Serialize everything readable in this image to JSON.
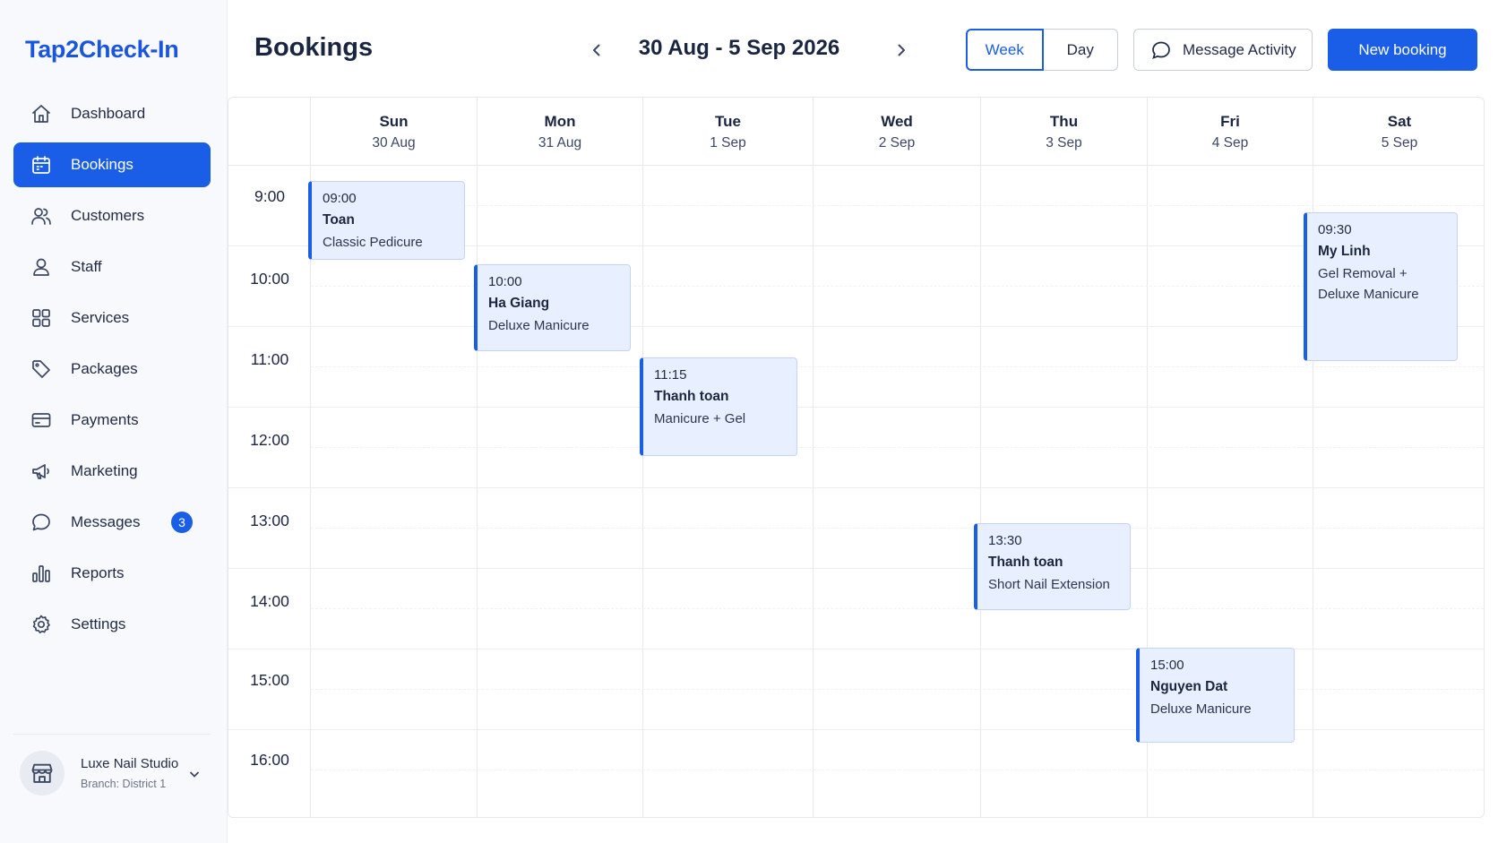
{
  "app": {
    "brand": "Tap2Check-In"
  },
  "sidebar": {
    "items": [
      {
        "label": "Dashboard",
        "icon": "home-icon"
      },
      {
        "label": "Bookings",
        "icon": "calendar-icon",
        "active": true
      },
      {
        "label": "Customers",
        "icon": "users-icon"
      },
      {
        "label": "Staff",
        "icon": "user-icon"
      },
      {
        "label": "Services",
        "icon": "grid-icon"
      },
      {
        "label": "Packages",
        "icon": "tag-icon"
      },
      {
        "label": "Payments",
        "icon": "card-icon"
      },
      {
        "label": "Marketing",
        "icon": "megaphone-icon"
      },
      {
        "label": "Messages",
        "icon": "chat-icon",
        "badge": "3"
      },
      {
        "label": "Reports",
        "icon": "bar-chart-icon"
      },
      {
        "label": "Settings",
        "icon": "gear-icon"
      }
    ],
    "studio": {
      "name": "Luxe Nail Studio",
      "branch": "Branch: District 1"
    }
  },
  "header": {
    "title": "Bookings",
    "date_range": "30 Aug - 5 Sep 2026",
    "view_week": "Week",
    "view_day": "Day",
    "active_view": "Week",
    "message_activity": "Message Activity",
    "new_booking": "New booking"
  },
  "calendar": {
    "days": [
      {
        "name": "Sun",
        "date": "30 Aug"
      },
      {
        "name": "Mon",
        "date": "31 Aug"
      },
      {
        "name": "Tue",
        "date": "1 Sep"
      },
      {
        "name": "Wed",
        "date": "2 Sep"
      },
      {
        "name": "Thu",
        "date": "3 Sep"
      },
      {
        "name": "Fri",
        "date": "4 Sep"
      },
      {
        "name": "Sat",
        "date": "5 Sep"
      }
    ],
    "hours": [
      "9:00",
      "10:00",
      "11:00",
      "12:00",
      "13:00",
      "14:00",
      "15:00",
      "16:00"
    ],
    "bookings": [
      {
        "time": "09:00",
        "name": "Toan",
        "service": "Classic Pedicure",
        "day": "Sun"
      },
      {
        "time": "10:00",
        "name": "Ha Giang",
        "service": "Deluxe Manicure",
        "day": "Mon"
      },
      {
        "time": "11:15",
        "name": "Thanh toan",
        "service": "Manicure + Gel",
        "day": "Tue"
      },
      {
        "time": "13:30",
        "name": "Thanh toan",
        "service": "Short Nail Extension",
        "day": "Thu"
      },
      {
        "time": "15:00",
        "name": "Nguyen Dat",
        "service": "Deluxe Manicure",
        "day": "Fri"
      },
      {
        "time": "09:30",
        "name": "My Linh",
        "service": "Gel Removal +\nDeluxe Manicure",
        "day": "Sat"
      }
    ]
  },
  "colors": {
    "accent": "#1a5ee8",
    "brand": "#1a56db",
    "event_bg": "#e8efff"
  }
}
